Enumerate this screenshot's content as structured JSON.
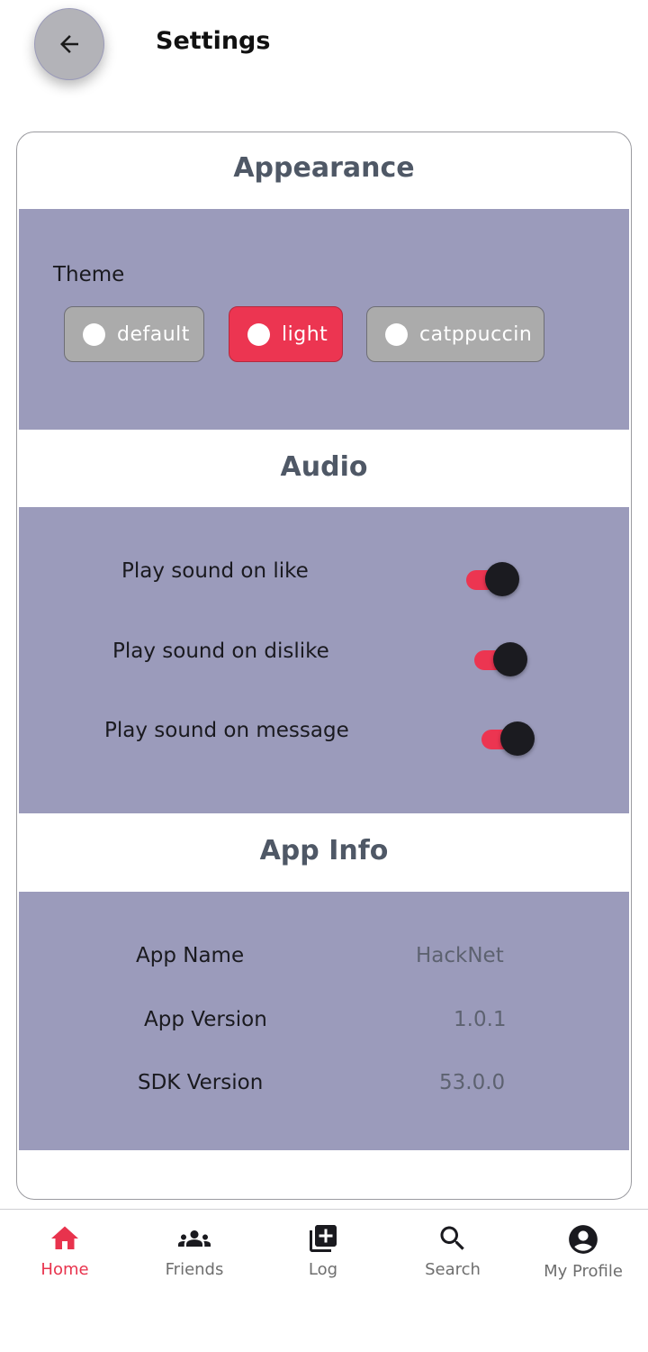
{
  "header": {
    "title": "Settings",
    "back_icon": "arrow-left-icon"
  },
  "appearance": {
    "title": "Appearance",
    "theme_label": "Theme",
    "themes": [
      {
        "label": "default",
        "selected": false
      },
      {
        "label": "light",
        "selected": true
      },
      {
        "label": "catppuccin",
        "selected": false
      }
    ]
  },
  "audio": {
    "title": "Audio",
    "toggles": [
      {
        "label": "Play sound on like",
        "on": true
      },
      {
        "label": "Play sound on dislike",
        "on": true
      },
      {
        "label": "Play sound on message",
        "on": true
      }
    ]
  },
  "app_info": {
    "title": "App Info",
    "rows": [
      {
        "label": "App Name",
        "value": "HackNet"
      },
      {
        "label": "App Version",
        "value": "1.0.1"
      },
      {
        "label": "SDK Version",
        "value": "53.0.0"
      }
    ]
  },
  "nav": {
    "items": [
      {
        "label": "Home",
        "icon": "home-icon",
        "active": true
      },
      {
        "label": "Friends",
        "icon": "friends-icon",
        "active": false
      },
      {
        "label": "Log",
        "icon": "add-post-icon",
        "active": false
      },
      {
        "label": "Search",
        "icon": "search-icon",
        "active": false
      },
      {
        "label": "My Profile",
        "icon": "profile-icon",
        "active": false
      }
    ]
  },
  "colors": {
    "accent": "#ec3551",
    "panel": "#9b9bbb",
    "section_title": "#4f5866",
    "inactive_chip": "#ababab",
    "toggle_thumb": "#1b1b20"
  }
}
